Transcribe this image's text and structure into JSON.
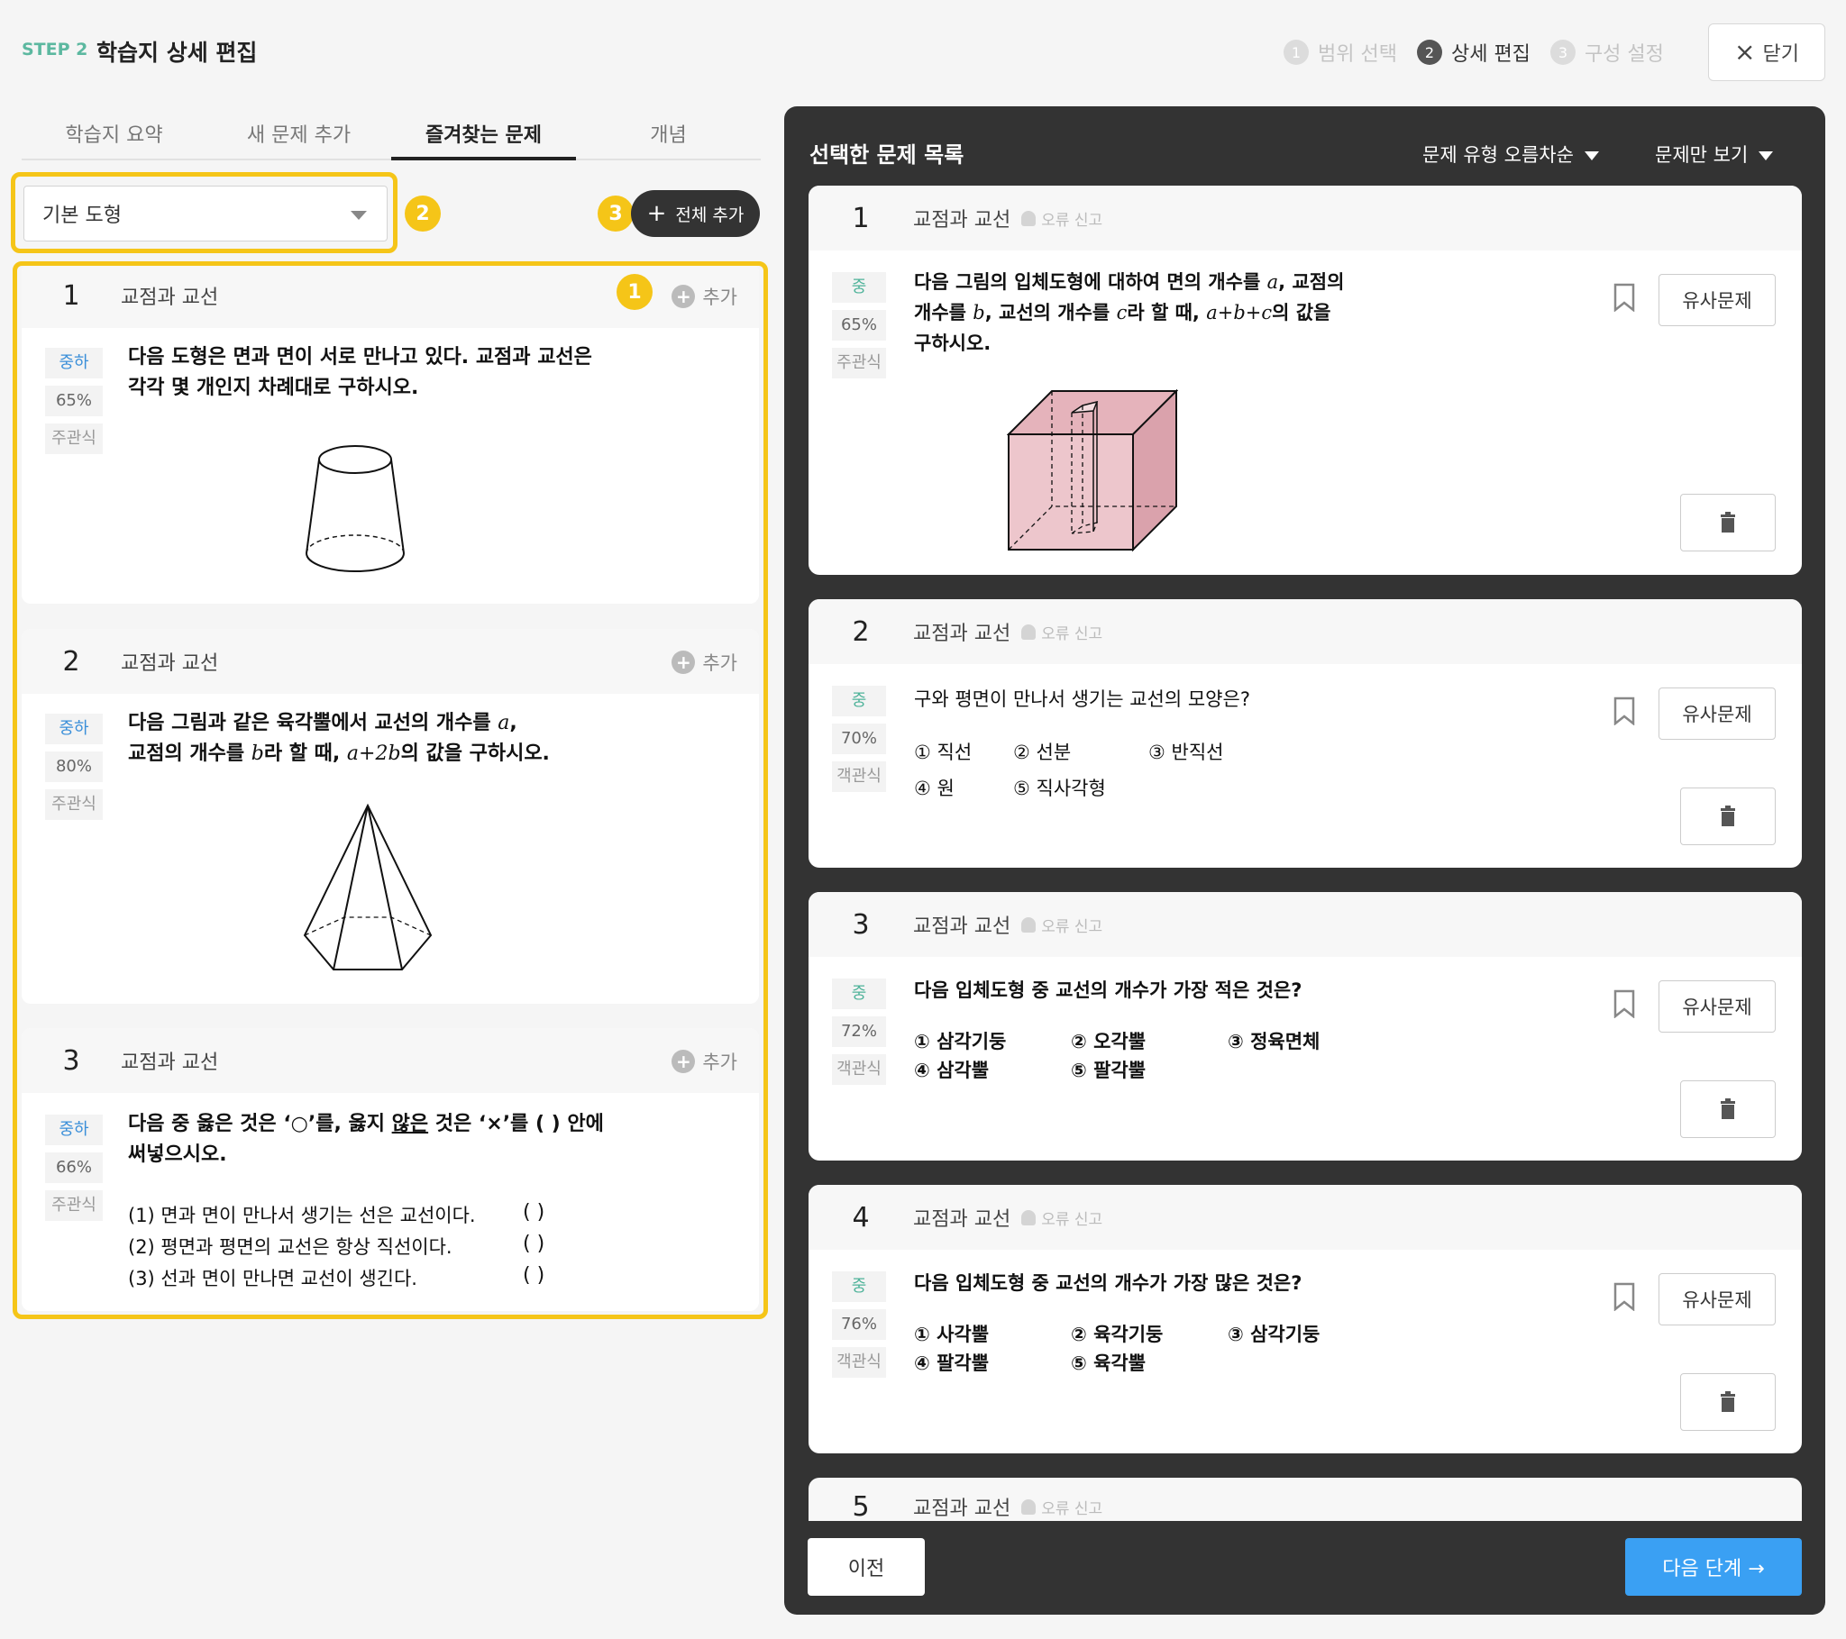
{
  "header": {
    "step_label": "STEP 2",
    "title": "학습지 상세 편집",
    "steps": [
      {
        "num": "1",
        "label": "범위 선택"
      },
      {
        "num": "2",
        "label": "상세 편집"
      },
      {
        "num": "3",
        "label": "구성 설정"
      }
    ],
    "close_label": "닫기"
  },
  "left": {
    "tabs": [
      "학습지 요약",
      "새 문제 추가",
      "즐겨찾는 문제",
      "개념"
    ],
    "filter_value": "기본 도형",
    "add_all_label": "전체 추가",
    "badges": [
      "1",
      "2",
      "3"
    ],
    "add_label": "추가",
    "questions": [
      {
        "num": "1",
        "topic": "교점과 교선",
        "level": "중하",
        "rate": "65%",
        "type": "주관식",
        "lines": [
          "다음 도형은 면과 면이 서로 만나고 있다. 교점과 교선은",
          "각각 몇 개인지 차례대로 구하시오."
        ]
      },
      {
        "num": "2",
        "topic": "교점과 교선",
        "level": "중하",
        "rate": "80%",
        "type": "주관식",
        "line1_a": "다음 그림과 같은 육각뿔에서 교선의 개수를 ",
        "line1_var": "a",
        "line1_b": ",",
        "line2_a": "교점의 개수를 ",
        "line2_var": "b",
        "line2_b": "라 할 때, ",
        "line2_expr": "a+2b",
        "line2_c": "의 값을 구하시오."
      },
      {
        "num": "3",
        "topic": "교점과 교선",
        "level": "중하",
        "rate": "66%",
        "type": "주관식",
        "line1_a": "다음 중 옳은 것은 ‘○’를, 옳지 ",
        "line1_u": "않은",
        "line1_b": " 것은 ‘×’를 (      ) 안에",
        "line2": "써넣으시오.",
        "items": [
          "(1) 면과 면이 만나서 생기는 선은 교선이다.",
          "(2) 평면과 평면의 교선은 항상 직선이다.",
          "(3) 선과 면이 만나면 교선이 생긴다."
        ],
        "blank": "(      )"
      }
    ]
  },
  "right": {
    "title": "선택한 문제 목록",
    "sort_label": "문제  유형 오름차순",
    "view_label": "문제만 보기",
    "error_label": "오류 신고",
    "similar_label": "유사문제",
    "prev_label": "이전",
    "next_label": "다음 단계 →",
    "questions": [
      {
        "num": "1",
        "topic": "교점과 교선",
        "level": "중",
        "rate": "65%",
        "type": "주관식",
        "l1_a": "다음 그림의 입체도형에 대하여 면의 개수를 ",
        "l1_v": "a",
        "l1_b": ", 교점의",
        "l2_a": "개수를 ",
        "l2_v": "b",
        "l2_b": ", 교선의 개수를 ",
        "l2_v2": "c",
        "l2_c": "라 할 때, ",
        "l2_expr": "a+b+c",
        "l2_d": "의 값을",
        "l3": "구하시오."
      },
      {
        "num": "2",
        "topic": "교점과 교선",
        "level": "중",
        "rate": "70%",
        "type": "객관식",
        "text": "구와 평면이 만나서 생기는 교선의 모양은?",
        "options": [
          "① 직선",
          "② 선분",
          "③ 반직선",
          "④ 원",
          "⑤ 직사각형"
        ]
      },
      {
        "num": "3",
        "topic": "교점과 교선",
        "level": "중",
        "rate": "72%",
        "type": "객관식",
        "text": "다음 입체도형 중 교선의 개수가 가장 적은 것은?",
        "options": [
          "① 삼각기둥",
          "② 오각뿔",
          "③ 정육면체",
          "④ 삼각뿔",
          "⑤ 팔각뿔"
        ]
      },
      {
        "num": "4",
        "topic": "교점과 교선",
        "level": "중",
        "rate": "76%",
        "type": "객관식",
        "text": "다음 입체도형 중 교선의 개수가 가장 많은 것은?",
        "options": [
          "① 사각뿔",
          "② 육각기둥",
          "③ 삼각기둥",
          "④ 팔각뿔",
          "⑤ 육각뿔"
        ]
      },
      {
        "num": "5",
        "topic": "교점과 교선"
      }
    ]
  },
  "colors": {
    "highlight": "#f5c518",
    "primary": "#3aa0f3",
    "level_green": "#4fb39a",
    "level_blue": "#3a8fd9",
    "panel_dark": "#333333"
  }
}
